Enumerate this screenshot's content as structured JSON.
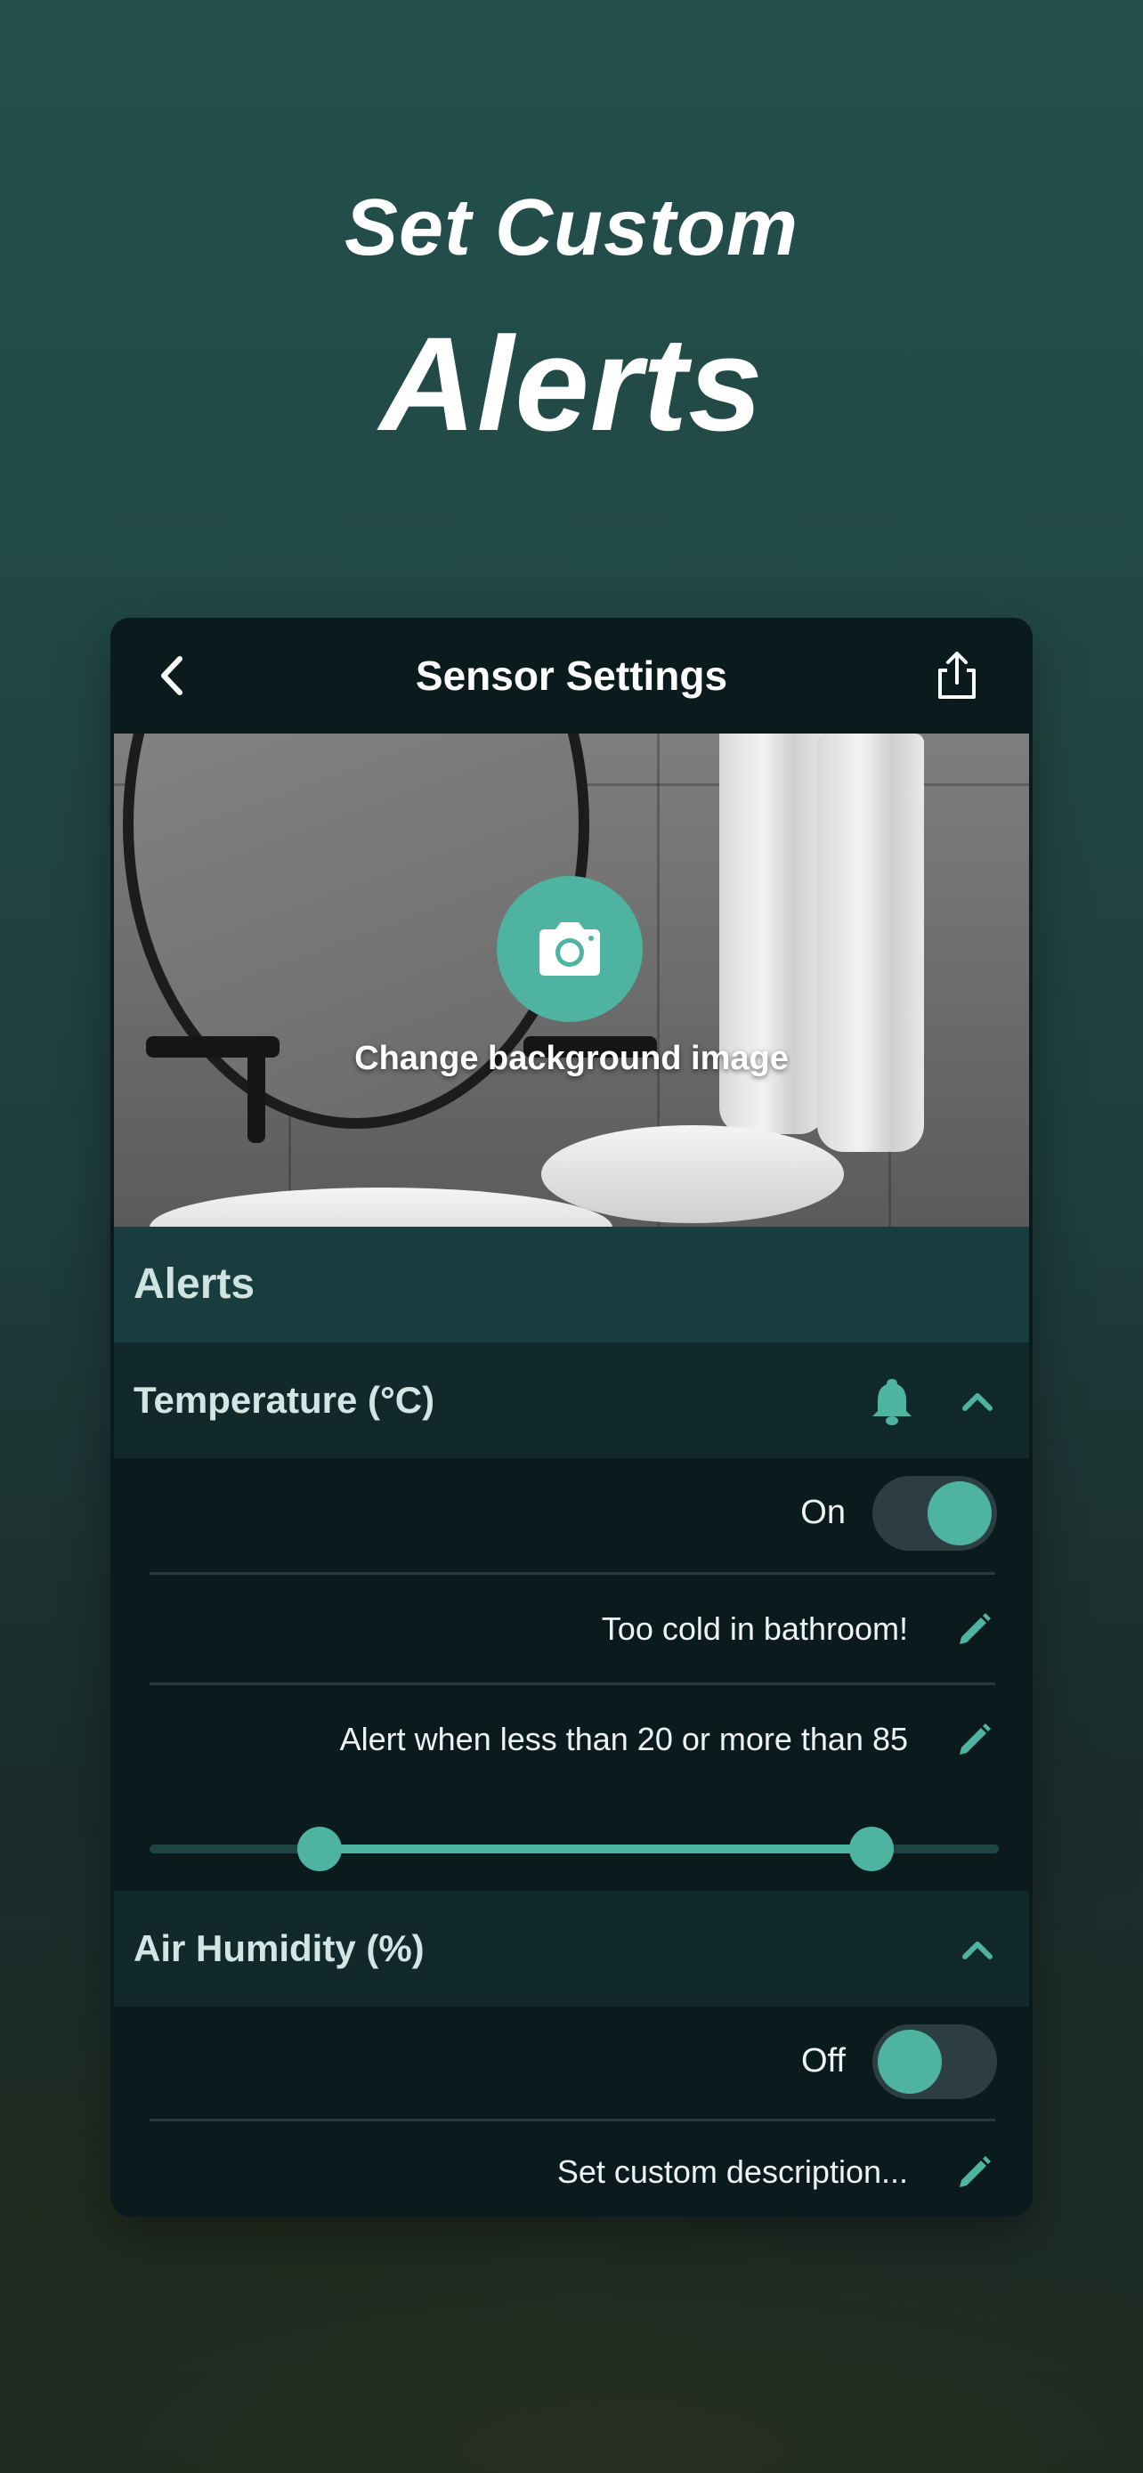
{
  "hero": {
    "line1": "Set Custom",
    "line2": "Alerts"
  },
  "nav": {
    "title": "Sensor Settings",
    "back_icon": "chevron-left-icon",
    "share_icon": "share-icon"
  },
  "background_image": {
    "label": "Change background image",
    "icon": "camera-icon"
  },
  "alerts": {
    "title": "Alerts",
    "temperature": {
      "title": "Temperature (°C)",
      "toggle_label": "On",
      "toggle_on": true,
      "description": "Too cold in bathroom!",
      "range_text": "Alert when less than 20 or more than 85",
      "range_low": 20,
      "range_high": 85
    },
    "humidity": {
      "title": "Air Humidity (%)",
      "toggle_label": "Off",
      "toggle_on": false,
      "description": "Set custom description..."
    }
  },
  "colors": {
    "accent": "#4fb3a1",
    "card_bg": "#0b1b1d",
    "section_bg": "#193c3f",
    "group_bg": "#12292c"
  }
}
